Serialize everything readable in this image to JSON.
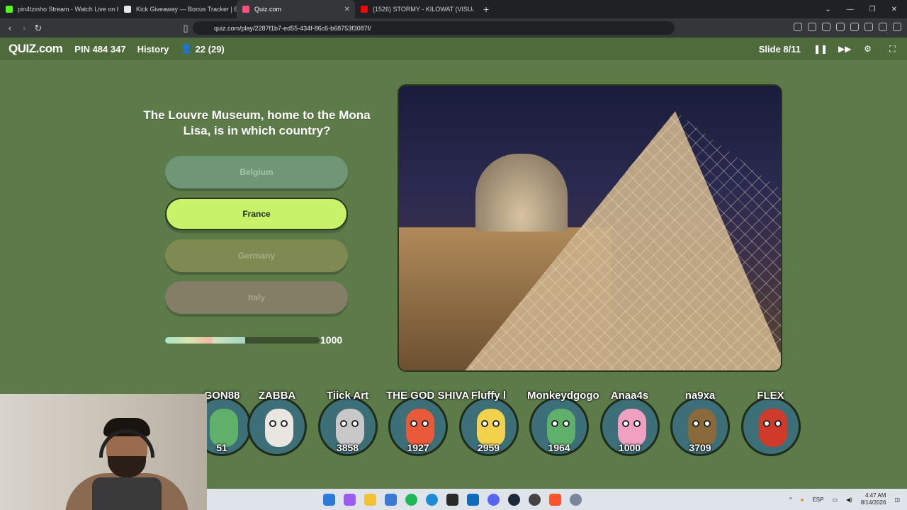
{
  "browser": {
    "tabs": [
      {
        "title": "pin4tzinho Stream - Watch Live on K",
        "favicon_color": "#53fc18"
      },
      {
        "title": "Kick Giveaway — Bonus Tracker | Bo",
        "favicon_color": "#e6e6e6"
      },
      {
        "title": "Quiz.com",
        "favicon_color": "#ff4f7b",
        "active": true
      },
      {
        "title": "(1526) STORMY - KILOWAT (VISUALI",
        "favicon_color": "#ff0000"
      }
    ],
    "url": "quiz.com/play/2287f1b7-ed55-434f-86c6-b68753f3087f/"
  },
  "header": {
    "logo": "QUIZ.com",
    "pin": "PIN 484 347",
    "history": "History",
    "players": "22 (29)",
    "slide": "Slide 8/11"
  },
  "question": {
    "text": "The Louvre Museum, home to the Mona Lisa, is in which country?",
    "answers": [
      "Belgium",
      "France",
      "Germany",
      "Italy"
    ],
    "selected_answer": "France"
  },
  "timer": {
    "progress": 0.52,
    "points": "1000"
  },
  "players": [
    {
      "name": "ZABBA",
      "score": "",
      "color": "#3d6f78",
      "face": "#e9e6e2"
    },
    {
      "name": "Tiick Art",
      "score": "3858",
      "color": "#3d6f78",
      "face": "#c8c8c8"
    },
    {
      "name": "THE GOD SHIVA",
      "score": "1927",
      "color": "#3d6f78",
      "face": "#e85a3a"
    },
    {
      "name": "Fluffy l",
      "score": "2959",
      "color": "#3d6f78",
      "face": "#f2d24a"
    },
    {
      "name": "Monkeydgogo",
      "score": "1964",
      "color": "#3d6f78",
      "face": "#5fb06a"
    },
    {
      "name": "Anaa4s",
      "score": "1000",
      "color": "#3d6f78",
      "face": "#f0a0c0"
    },
    {
      "name": "na9xa",
      "score": "3709",
      "color": "#3d6f78",
      "face": "#8a6a3a"
    },
    {
      "name": "FLEX",
      "score": "",
      "color": "#3d6f78",
      "face": "#d03a2a"
    }
  ],
  "partial_player": {
    "name": "GON88",
    "score": "51"
  },
  "taskbar": {
    "lang": "ESP",
    "time": "4:47 AM",
    "date": "8/14/2026"
  }
}
